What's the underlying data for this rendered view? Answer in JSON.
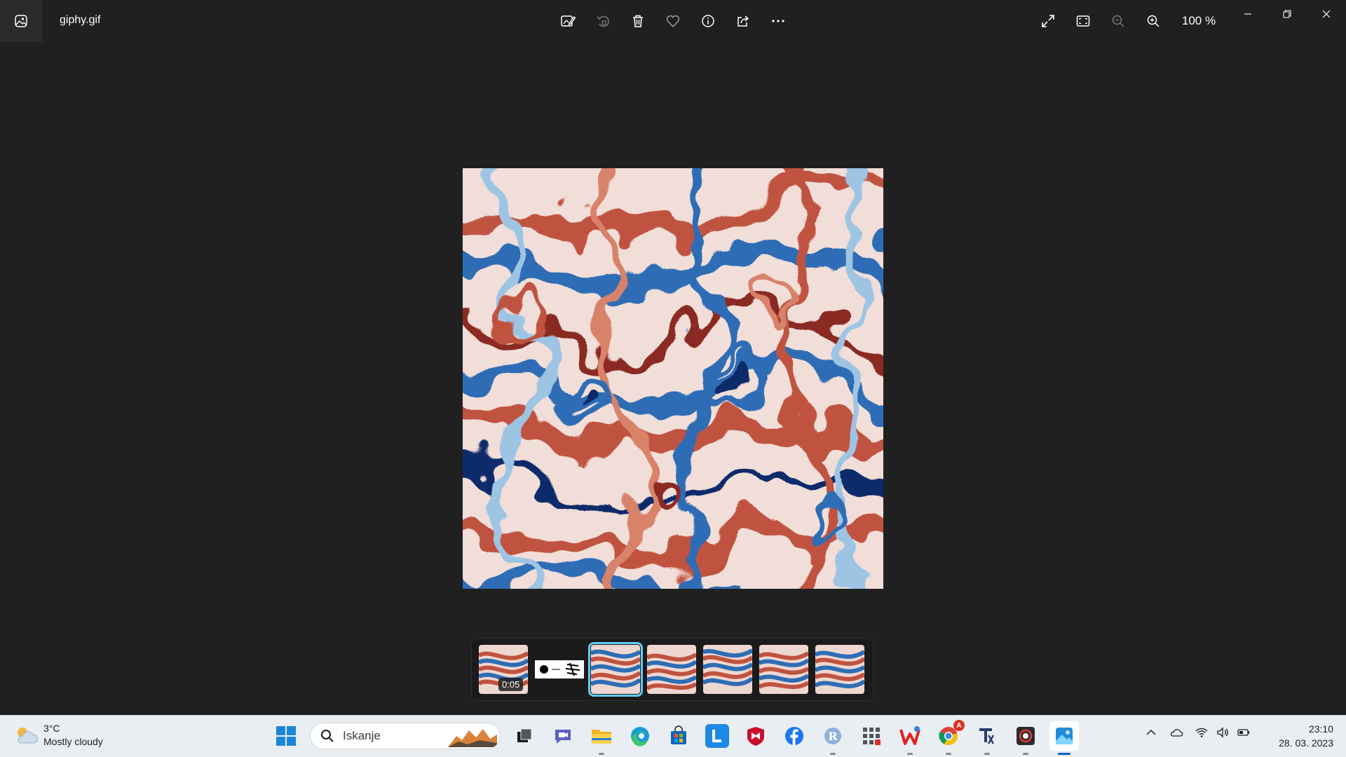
{
  "app": {
    "file_name": "giphy.gif",
    "zoom_level": "100 %"
  },
  "toolbar": {
    "buttons": [
      "edit-image",
      "rotate",
      "delete",
      "favorite",
      "file-info",
      "share",
      "see-more"
    ],
    "right_buttons": [
      "full-screen",
      "fit-to-window",
      "zoom-out",
      "zoom-in"
    ]
  },
  "filmstrip": {
    "thumbnails": [
      {
        "kind": "video",
        "duration": "0:05"
      },
      {
        "kind": "image"
      },
      {
        "kind": "image",
        "selected": true
      },
      {
        "kind": "image"
      },
      {
        "kind": "image"
      },
      {
        "kind": "image"
      },
      {
        "kind": "image"
      }
    ],
    "accent_color": "#60cdff"
  },
  "taskbar": {
    "weather": {
      "temperature": "3°C",
      "condition": "Mostly cloudy"
    },
    "search_placeholder": "Iskanje",
    "apps": [
      "task-view",
      "teams-chat",
      "file-explorer",
      "edge",
      "microsoft-store",
      "l-app",
      "mcafee",
      "facebook",
      "r-app",
      "calculator-grid",
      "wps-office",
      "chrome",
      "t-app",
      "recorder",
      "photos"
    ],
    "chrome_badge": "A",
    "clock": {
      "time": "23:10",
      "date": "28. 03. 2023"
    }
  },
  "colors": {
    "background": "#202020",
    "taskbar": "#e9eef3",
    "image_red": "#c0533f",
    "image_blue": "#2d6db5",
    "image_navy": "#0b2a6b"
  }
}
